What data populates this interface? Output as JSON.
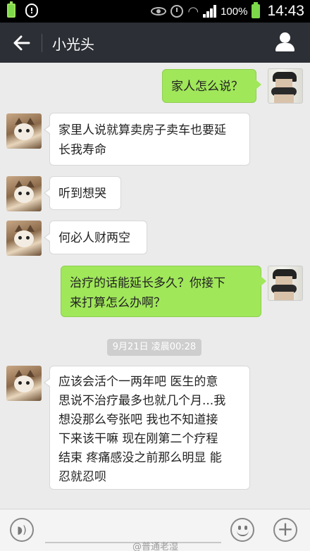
{
  "status_bar": {
    "left_battery_label": "100%",
    "battery_percent": "100%",
    "time": "14:43"
  },
  "header": {
    "back_icon": "back-arrow-icon",
    "title": "小光头",
    "profile_icon": "person-icon"
  },
  "messages": [
    {
      "side": "out",
      "text": "家人怎么说？"
    },
    {
      "side": "in",
      "lines": [
        "家里人说就算卖房子卖车也要延",
        "长我寿命"
      ]
    },
    {
      "side": "in",
      "text": "听到想哭"
    },
    {
      "side": "in",
      "text": "何必人财两空"
    },
    {
      "side": "out",
      "lines": [
        "治疗的话能延长多久？你接下",
        "来打算怎么办啊？"
      ]
    },
    {
      "side": "time",
      "text": "9月21日 凌晨00:28"
    },
    {
      "side": "in",
      "lines": [
        "应该会活个一两年吧 医生的意",
        "思说不治疗最多也就几个月...我",
        "想没那么夸张吧 我也不知道接",
        "下来该干嘛 现在刚第二个疗程",
        "结束 疼痛感没之前那么明显 能",
        "忍就忍呗"
      ]
    }
  ],
  "input_bar": {
    "voice_icon": "voice-icon",
    "emoji_icon": "emoji-icon",
    "plus_icon": "plus-icon",
    "watermark": "@普通老湿"
  },
  "colors": {
    "titlebar": "#2c2f35",
    "background": "#ebebeb",
    "outgoing_bubble": "#a0e75a",
    "incoming_bubble": "#ffffff"
  }
}
